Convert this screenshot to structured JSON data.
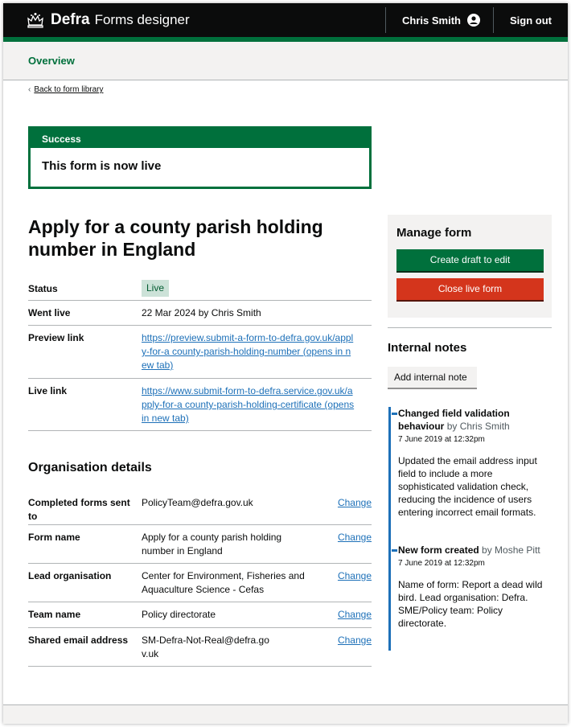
{
  "header": {
    "brand": "Defra",
    "product": "Forms designer",
    "user_name": "Chris Smith",
    "sign_out": "Sign out"
  },
  "subnav": {
    "overview": "Overview"
  },
  "back_link": "Back to form library",
  "banner": {
    "heading": "Success",
    "message": "This form is now live"
  },
  "page_title": "Apply for a county parish holding number in England",
  "form_summary": {
    "status_key": "Status",
    "status_value": "Live",
    "went_live_key": "Went live",
    "went_live_value": "22 Mar 2024 by Chris Smith",
    "preview_key": "Preview link",
    "preview_value": "https://preview.submit-a-form-to-defra.gov.uk/apply-for-a county-parish-holding-number (opens in new tab)",
    "live_key": "Live link",
    "live_value": "https://www.submit-form-to-defra.service.gov.uk/apply-for-a county-parish-holding-certificate (opens in new tab)"
  },
  "organisation": {
    "title": "Organisation details",
    "change_label": "Change",
    "rows": [
      {
        "key": "Completed forms sent to",
        "value": "PolicyTeam@defra.gov.uk"
      },
      {
        "key": "Form name",
        "value": "Apply for a county parish holding number in England"
      },
      {
        "key": "Lead organisation",
        "value": "Center for Environment, Fisheries and Aquaculture Science - Cefas"
      },
      {
        "key": "Team name",
        "value": "Policy directorate"
      },
      {
        "key": "Shared email address",
        "value": "SM-Defra-Not-Real@defra.gov.uk"
      }
    ]
  },
  "manage": {
    "title": "Manage form",
    "create_draft": "Create draft to edit",
    "close_live": "Close live form"
  },
  "notes": {
    "title": "Internal notes",
    "add_button": "Add internal note",
    "entries": [
      {
        "title": "Changed field validation behaviour",
        "by": "by Chris Smith",
        "date": "7 June 2019 at 12:32pm",
        "body": "Updated the email address input field to include a more sophisticated validation check, reducing the incidence of users entering incorrect email formats."
      },
      {
        "title": "New form created",
        "by": "by Moshe Pitt",
        "date": "7 June 2019 at 12:32pm",
        "body": "Name of form: Report a dead wild bird. Lead organisation: Defra. SME/Policy team: Policy directorate."
      }
    ]
  },
  "colors": {
    "header_bg": "#0b0c0c",
    "brand_green": "#00703c",
    "link_blue": "#1d70b8",
    "danger_red": "#d4351c",
    "tag_bg": "#cce2d8"
  },
  "icons": {
    "crown": "crown-icon",
    "user": "user-circle-icon",
    "back": "chevron-left-icon"
  }
}
